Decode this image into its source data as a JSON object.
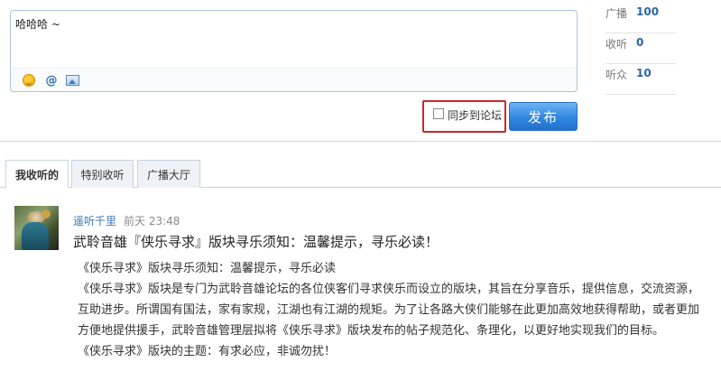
{
  "compose": {
    "text": "哈哈哈 ~",
    "toolbar": {
      "emoji_icon": "emoji-icon",
      "at_label": "@",
      "image_icon": "image-icon"
    }
  },
  "stats": [
    {
      "label": "广播",
      "value": "100"
    },
    {
      "label": "收听",
      "value": "0"
    },
    {
      "label": "听众",
      "value": "10"
    }
  ],
  "sync": {
    "label": "同步到论坛",
    "checked": false
  },
  "publish_label": "发布",
  "tabs": [
    {
      "label": "我收听的",
      "active": true
    },
    {
      "label": "特别收听",
      "active": false
    },
    {
      "label": "广播大厅",
      "active": false
    }
  ],
  "post": {
    "author": "遥听千里",
    "time": "前天 23:48",
    "title": "武聆音雄『侠乐寻求』版块寻乐须知：温馨提示，寻乐必读！",
    "lines": [
      "《侠乐寻求》版块寻乐须知：温馨提示，寻乐必读",
      "《侠乐寻求》版块是专门为武聆音雄论坛的各位侠客们寻求侠乐而设立的版块，其旨在分享音乐，提供信息，交流资源，互助进步。所谓国有国法，家有家规，江湖也有江湖的规矩。为了让各路大侠们能够在此更加高效地获得帮助，或者更加方便地提供援手，武聆音雄管理层拟将《侠乐寻求》版块发布的帖子规范化、条理化，以更好地实现我们的目标。",
      "《侠乐寻求》版块的主题：有求必应，非诚勿扰！"
    ]
  }
}
